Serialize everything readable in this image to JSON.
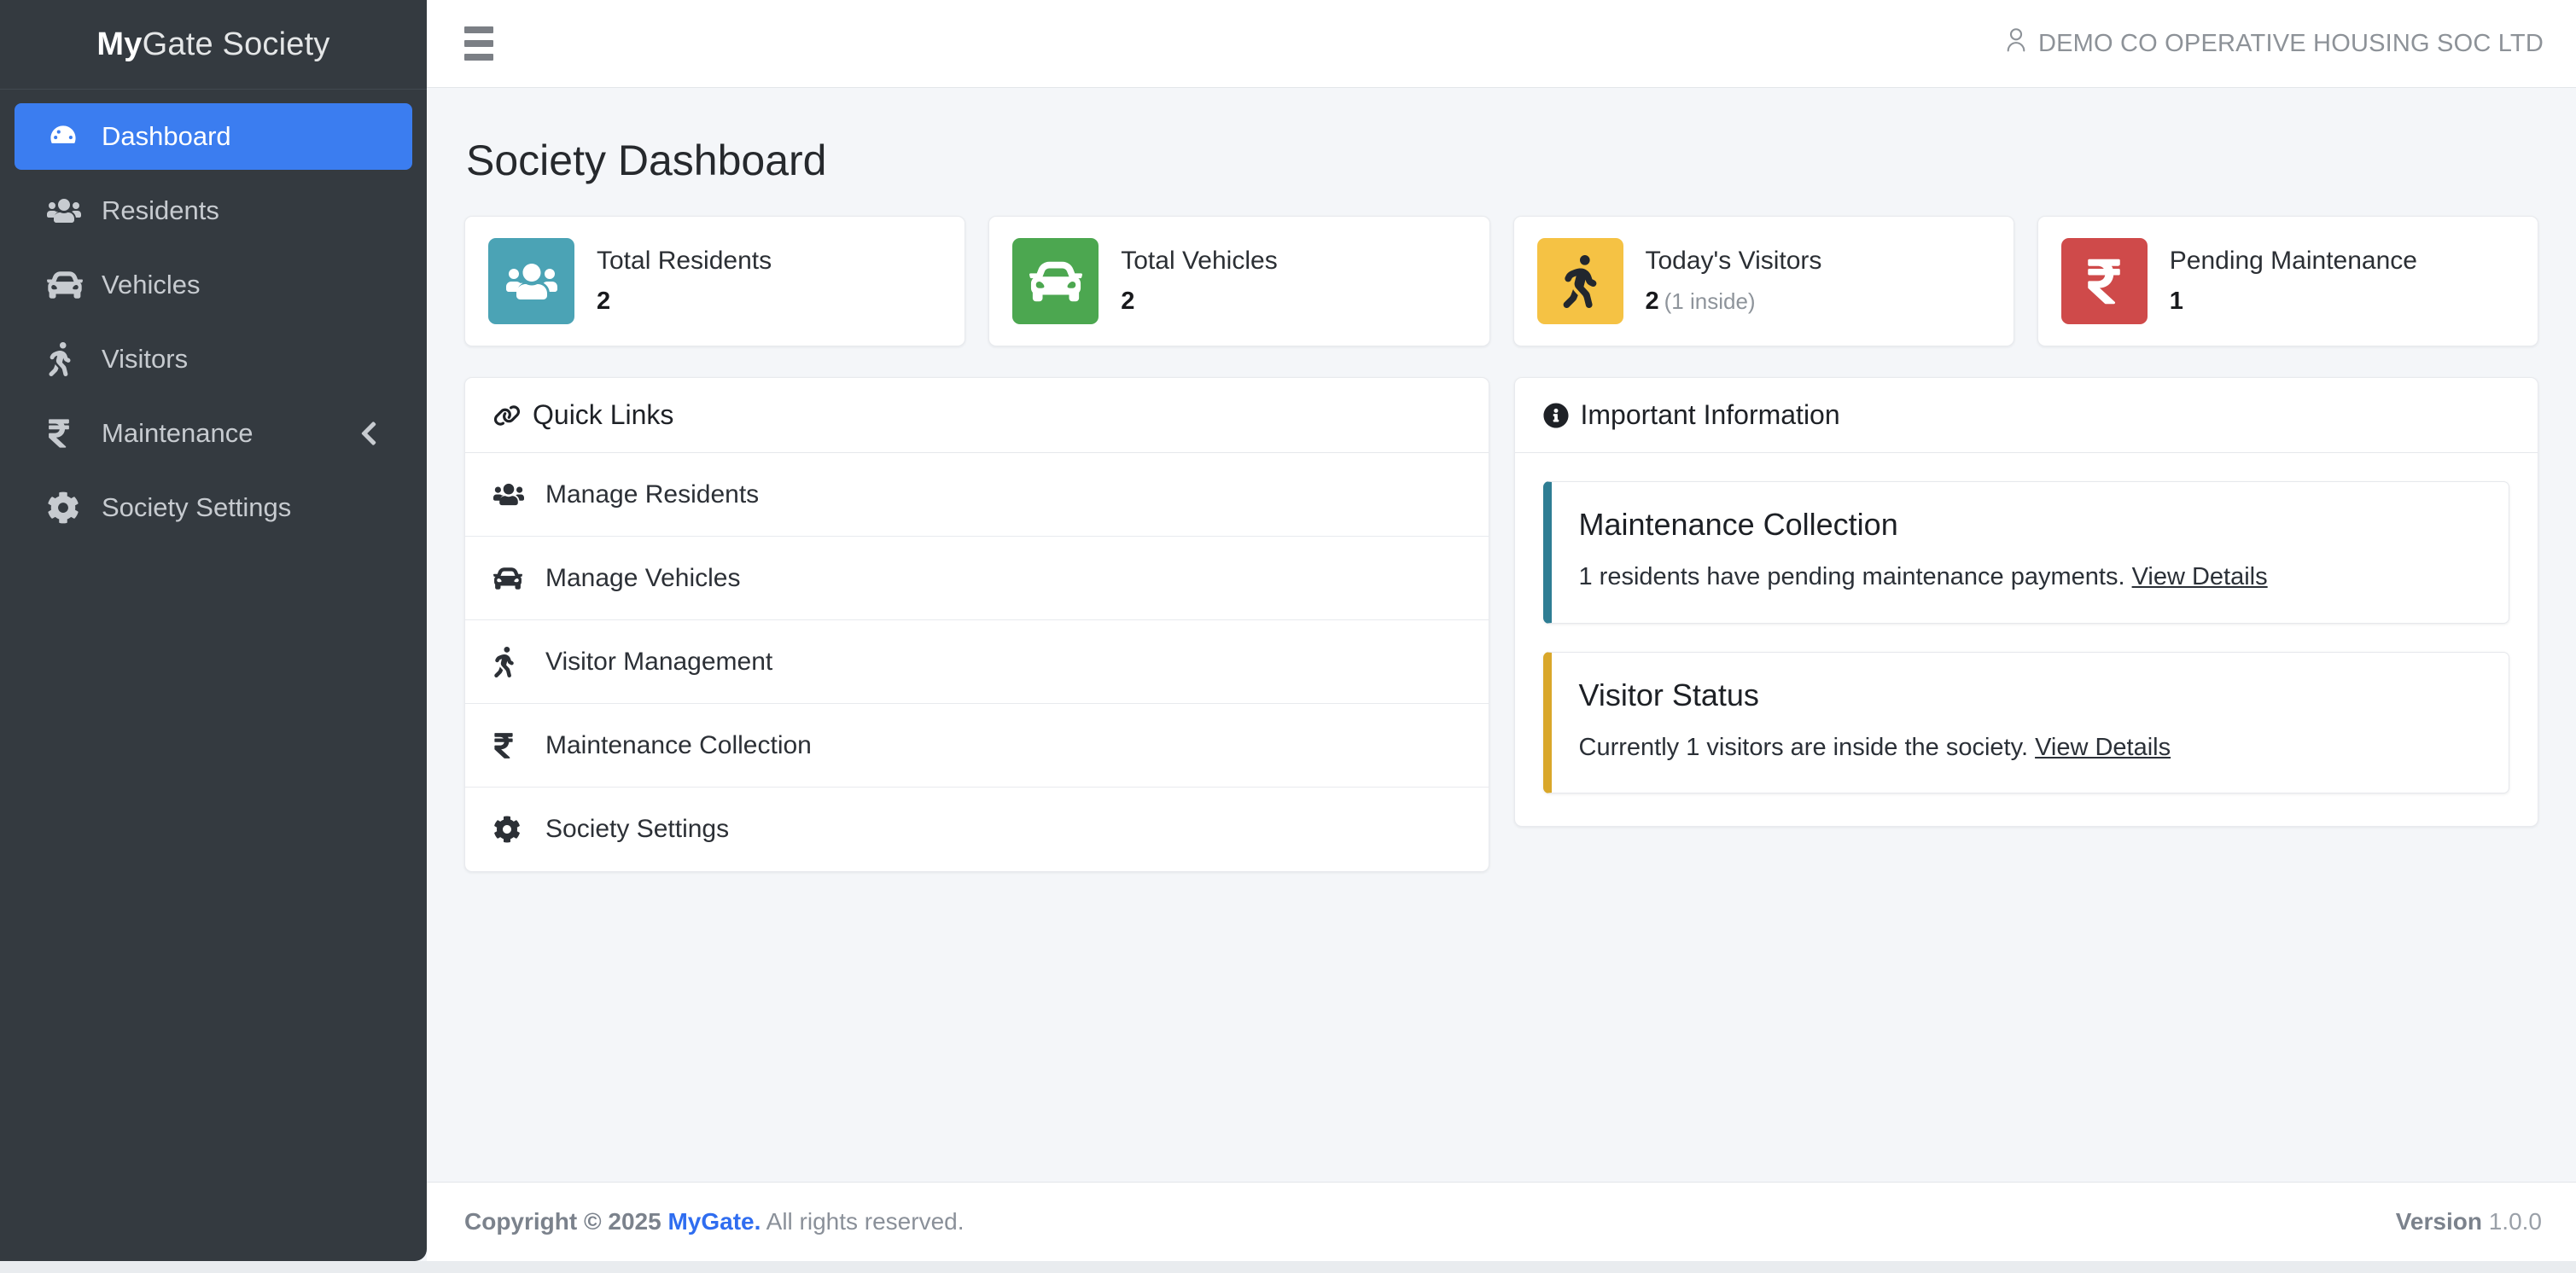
{
  "brand": {
    "strong": "My",
    "rest": "Gate Society"
  },
  "sidebar": {
    "items": [
      {
        "label": "Dashboard",
        "icon": "dashboard-gauge-icon",
        "active": true
      },
      {
        "label": "Residents",
        "icon": "users-group-icon",
        "active": false
      },
      {
        "label": "Vehicles",
        "icon": "car-icon",
        "active": false
      },
      {
        "label": "Visitors",
        "icon": "walking-person-icon",
        "active": false
      },
      {
        "label": "Maintenance",
        "icon": "rupee-icon",
        "active": false,
        "chevron": "chevron-left-icon"
      },
      {
        "label": "Society Settings",
        "icon": "gear-icon",
        "active": false
      }
    ]
  },
  "topbar": {
    "menu_icon": "hamburger-menu-icon",
    "user_icon": "user-outline-icon",
    "society_name": "DEMO CO OPERATIVE HOUSING SOC LTD"
  },
  "page": {
    "title": "Society Dashboard"
  },
  "stats": [
    {
      "label": "Total Residents",
      "value": "2",
      "sub": "",
      "icon": "users-group-icon",
      "color": "#4ba3b5",
      "icon_color": "#ffffff"
    },
    {
      "label": "Total Vehicles",
      "value": "2",
      "sub": "",
      "icon": "car-icon",
      "color": "#4ca750",
      "icon_color": "#ffffff"
    },
    {
      "label": "Today's Visitors",
      "value": "2",
      "sub": "(1 inside)",
      "icon": "walking-person-icon",
      "color": "#f5c244",
      "icon_color": "#22272e"
    },
    {
      "label": "Pending Maintenance",
      "value": "1",
      "sub": "",
      "icon": "rupee-icon",
      "color": "#cf4a4a",
      "icon_color": "#ffffff"
    }
  ],
  "quick_links": {
    "title": "Quick Links",
    "title_icon": "link-chain-icon",
    "items": [
      {
        "label": "Manage Residents",
        "icon": "users-group-icon"
      },
      {
        "label": "Manage Vehicles",
        "icon": "car-icon"
      },
      {
        "label": "Visitor Management",
        "icon": "walking-person-icon"
      },
      {
        "label": "Maintenance Collection",
        "icon": "rupee-icon"
      },
      {
        "label": "Society Settings",
        "icon": "gear-icon"
      }
    ]
  },
  "important_information": {
    "title": "Important Information",
    "title_icon": "info-circle-icon",
    "alerts": [
      {
        "title": "Maintenance Collection",
        "text": "1 residents have pending maintenance payments.",
        "link": "View Details",
        "accent": "#2e7d93"
      },
      {
        "title": "Visitor Status",
        "text": "Currently 1 visitors are inside the society.",
        "link": "View Details",
        "accent": "#d9a72a"
      }
    ]
  },
  "footer": {
    "copyright_strong": "Copyright © 2025",
    "brand": "MyGate.",
    "rights": "All rights reserved.",
    "version_label": "Version",
    "version_number": "1.0.0"
  }
}
